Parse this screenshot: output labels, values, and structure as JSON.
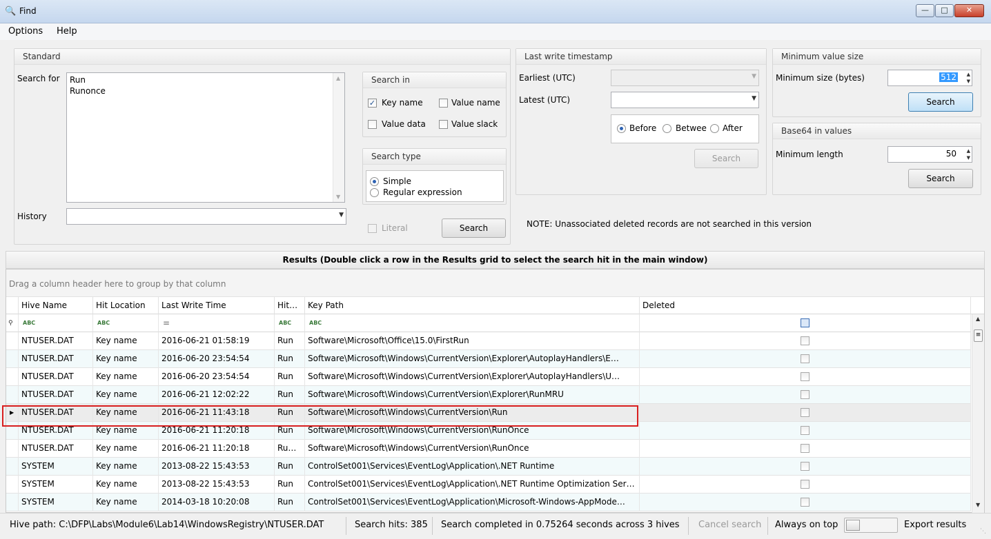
{
  "window": {
    "title": "Find"
  },
  "menu": {
    "options": "Options",
    "help": "Help"
  },
  "standard": {
    "title": "Standard",
    "search_for_label": "Search for",
    "search_terms": [
      "Run",
      "Runonce"
    ],
    "history_label": "History",
    "history_value": ""
  },
  "search_in": {
    "title": "Search in",
    "key_name": {
      "label": "Key name",
      "checked": true
    },
    "value_name": {
      "label": "Value name",
      "checked": false
    },
    "value_data": {
      "label": "Value data",
      "checked": false
    },
    "value_slack": {
      "label": "Value slack",
      "checked": false
    }
  },
  "search_type": {
    "title": "Search type",
    "simple": "Simple",
    "regex": "Regular expression",
    "selected": "Simple"
  },
  "literal": {
    "label": "Literal",
    "checked": false
  },
  "search_button_main": "Search",
  "last_write": {
    "title": "Last write timestamp",
    "earliest_label": "Earliest (UTC)",
    "latest_label": "Latest (UTC)",
    "before": "Before",
    "between": "Betwee",
    "after": "After",
    "selected": "Before",
    "search_button": "Search"
  },
  "min_value_size": {
    "title": "Minimum value size",
    "label": "Minimum size (bytes)",
    "value": "512",
    "search_button": "Search"
  },
  "base64": {
    "title": "Base64 in values",
    "label": "Minimum length",
    "value": "50",
    "search_button": "Search"
  },
  "note": "NOTE: Unassociated deleted records are not searched in this version",
  "results": {
    "header": "Results (Double click a row in the Results grid to select the search hit in the main window)",
    "group_hint": "Drag a column header here to group by that column",
    "columns": [
      "Hive Name",
      "Hit Location",
      "Last Write Time",
      "Hit…",
      "Key Path",
      "Deleted"
    ],
    "filter_icon": "pin-icon",
    "rows": [
      [
        "NTUSER.DAT",
        "Key name",
        "2016-06-21 01:58:19",
        "Run",
        "Software\\Microsoft\\Office\\15.0\\FirstRun"
      ],
      [
        "NTUSER.DAT",
        "Key name",
        "2016-06-20 23:54:54",
        "Run",
        "Software\\Microsoft\\Windows\\CurrentVersion\\Explorer\\AutoplayHandlers\\E…"
      ],
      [
        "NTUSER.DAT",
        "Key name",
        "2016-06-20 23:54:54",
        "Run",
        "Software\\Microsoft\\Windows\\CurrentVersion\\Explorer\\AutoplayHandlers\\U…"
      ],
      [
        "NTUSER.DAT",
        "Key name",
        "2016-06-21 12:02:22",
        "Run",
        "Software\\Microsoft\\Windows\\CurrentVersion\\Explorer\\RunMRU"
      ],
      [
        "NTUSER.DAT",
        "Key name",
        "2016-06-21 11:43:18",
        "Run",
        "Software\\Microsoft\\Windows\\CurrentVersion\\Run"
      ],
      [
        "NTUSER.DAT",
        "Key name",
        "2016-06-21 11:20:18",
        "Run",
        "Software\\Microsoft\\Windows\\CurrentVersion\\RunOnce"
      ],
      [
        "NTUSER.DAT",
        "Key name",
        "2016-06-21 11:20:18",
        "Ru…",
        "Software\\Microsoft\\Windows\\CurrentVersion\\RunOnce"
      ],
      [
        "SYSTEM",
        "Key name",
        "2013-08-22 15:43:53",
        "Run",
        "ControlSet001\\Services\\EventLog\\Application\\.NET Runtime"
      ],
      [
        "SYSTEM",
        "Key name",
        "2013-08-22 15:43:53",
        "Run",
        "ControlSet001\\Services\\EventLog\\Application\\.NET Runtime Optimization Ser…"
      ],
      [
        "SYSTEM",
        "Key name",
        "2014-03-18 10:20:08",
        "Run",
        "ControlSet001\\Services\\EventLog\\Application\\Microsoft-Windows-AppMode…"
      ]
    ],
    "selected_row": 4
  },
  "status": {
    "hive_path": "Hive path: C:\\DFP\\Labs\\Module6\\Lab14\\WindowsRegistry\\NTUSER.DAT",
    "hits": "Search hits: 385",
    "completed": "Search completed in 0.75264 seconds across 3 hives",
    "cancel": "Cancel search",
    "always_on_top": "Always on top",
    "export": "Export results"
  },
  "colors": {
    "highlight": "#d81e1e",
    "accent": "#2d62b3"
  }
}
